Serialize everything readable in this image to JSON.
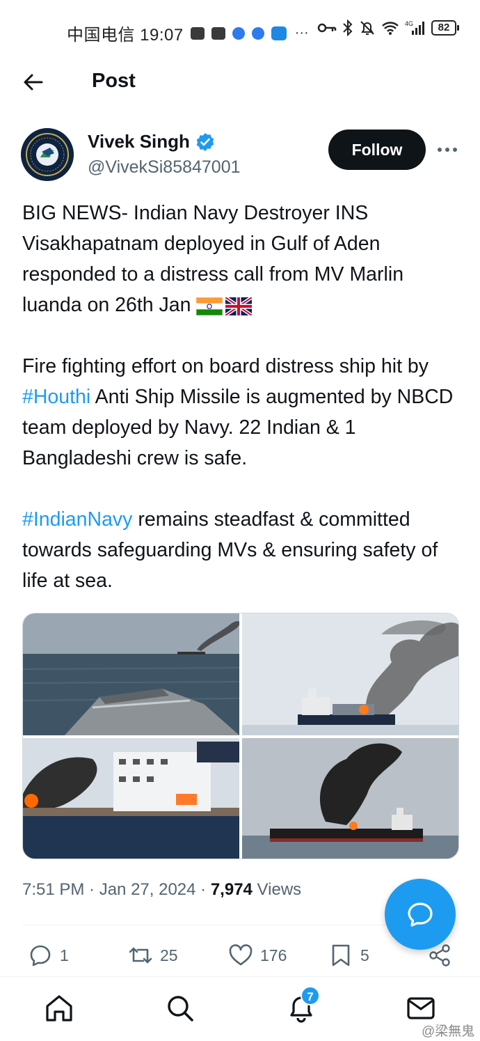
{
  "status_bar": {
    "carrier_time": "中国电信 19:07",
    "more": "···",
    "battery": "82"
  },
  "header": {
    "title": "Post"
  },
  "author": {
    "name": "Vivek Singh",
    "handle": "@VivekSi85847001",
    "follow_label": "Follow"
  },
  "tweet": {
    "p1": "BIG NEWS- Indian Navy Destroyer INS Visakhapatnam deployed in Gulf of Aden responded to a distress call from MV Marlin luanda on 26th Jan",
    "p2_a": "Fire fighting effort on board distress ship hit by ",
    "p2_tag": "#Houthi",
    "p2_b": " Anti Ship Missile is augmented by NBCD team deployed by Navy. 22 Indian & 1 Bangladeshi crew is safe.",
    "p3_tag": "#IndianNavy",
    "p3_b": " remains steadfast & committed towards safeguarding MVs & ensuring safety of life at sea."
  },
  "meta": {
    "time_date": "7:51 PM · Jan 27, 2024 · ",
    "views_count": "7,974",
    "views_label": " Views"
  },
  "actions": {
    "replies": "1",
    "reposts": "25",
    "likes": "176",
    "bookmarks": "5"
  },
  "nav": {
    "notifications_badge": "7"
  },
  "watermark": "@梁無鬼",
  "colors": {
    "accent": "#1d9bf0",
    "text": "#0f1419",
    "secondary": "#536471"
  },
  "icons": [
    "back-arrow-icon",
    "verified-icon",
    "more-icon",
    "reply-icon",
    "repost-icon",
    "like-icon",
    "bookmark-icon",
    "share-icon",
    "compose-icon",
    "home-icon",
    "search-icon",
    "notifications-icon",
    "messages-icon"
  ]
}
